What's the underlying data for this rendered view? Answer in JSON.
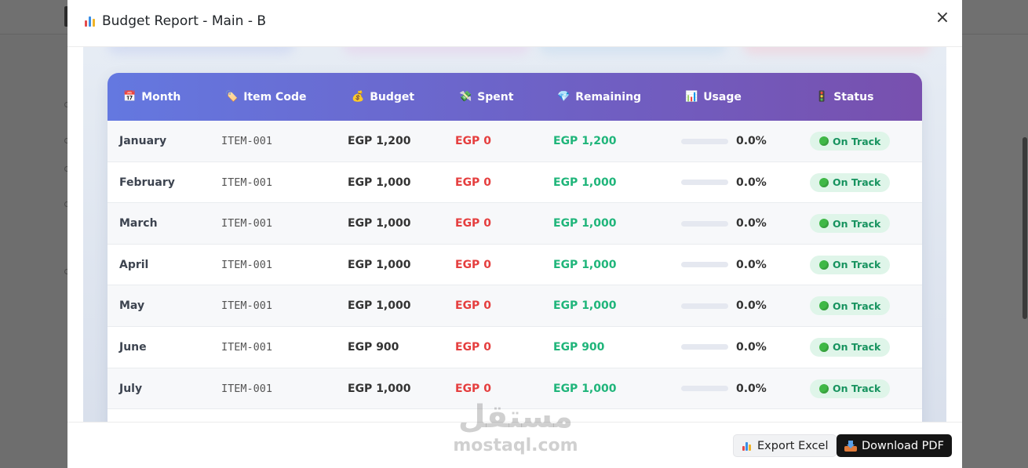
{
  "modal": {
    "title": "Budget Report - Main - B",
    "close_label": "×"
  },
  "table": {
    "headers": [
      {
        "icon": "📅",
        "label": "Month"
      },
      {
        "icon": "🏷️",
        "label": "Item Code"
      },
      {
        "icon": "💰",
        "label": "Budget"
      },
      {
        "icon": "💸",
        "label": "Spent"
      },
      {
        "icon": "💎",
        "label": "Remaining"
      },
      {
        "icon": "📊",
        "label": "Usage"
      },
      {
        "icon": "🚦",
        "label": "Status"
      }
    ],
    "rows": [
      {
        "month": "January",
        "code": "ITEM-001",
        "budget": "EGP 1,200",
        "spent": "EGP 0",
        "remaining": "EGP 1,200",
        "usage": "0.0%",
        "usage_fraction": 0,
        "status": "On Track"
      },
      {
        "month": "February",
        "code": "ITEM-001",
        "budget": "EGP 1,000",
        "spent": "EGP 0",
        "remaining": "EGP 1,000",
        "usage": "0.0%",
        "usage_fraction": 0,
        "status": "On Track"
      },
      {
        "month": "March",
        "code": "ITEM-001",
        "budget": "EGP 1,000",
        "spent": "EGP 0",
        "remaining": "EGP 1,000",
        "usage": "0.0%",
        "usage_fraction": 0,
        "status": "On Track"
      },
      {
        "month": "April",
        "code": "ITEM-001",
        "budget": "EGP 1,000",
        "spent": "EGP 0",
        "remaining": "EGP 1,000",
        "usage": "0.0%",
        "usage_fraction": 0,
        "status": "On Track"
      },
      {
        "month": "May",
        "code": "ITEM-001",
        "budget": "EGP 1,000",
        "spent": "EGP 0",
        "remaining": "EGP 1,000",
        "usage": "0.0%",
        "usage_fraction": 0,
        "status": "On Track"
      },
      {
        "month": "June",
        "code": "ITEM-001",
        "budget": "EGP 900",
        "spent": "EGP 0",
        "remaining": "EGP 900",
        "usage": "0.0%",
        "usage_fraction": 0,
        "status": "On Track"
      },
      {
        "month": "July",
        "code": "ITEM-001",
        "budget": "EGP 1,000",
        "spent": "EGP 0",
        "remaining": "EGP 1,000",
        "usage": "0.0%",
        "usage_fraction": 0,
        "status": "On Track"
      }
    ]
  },
  "footer": {
    "export_excel_label": "Export Excel",
    "download_pdf_label": "Download PDF"
  },
  "watermark": {
    "arabic": "مستقل",
    "latin": "mostaql.com"
  },
  "colors": {
    "header_gradient_start": "#6478e0",
    "header_gradient_end": "#7850ae",
    "spent": "#e53e3e",
    "remaining": "#1fb57a",
    "status_badge_bg": "#dff5e9",
    "status_badge_text": "#17935f"
  },
  "icons": {
    "title": "bar-chart-icon",
    "close": "close-icon",
    "export_excel": "bar-chart-icon",
    "download_pdf": "inbox-tray-icon",
    "status": "green-circle-icon"
  }
}
